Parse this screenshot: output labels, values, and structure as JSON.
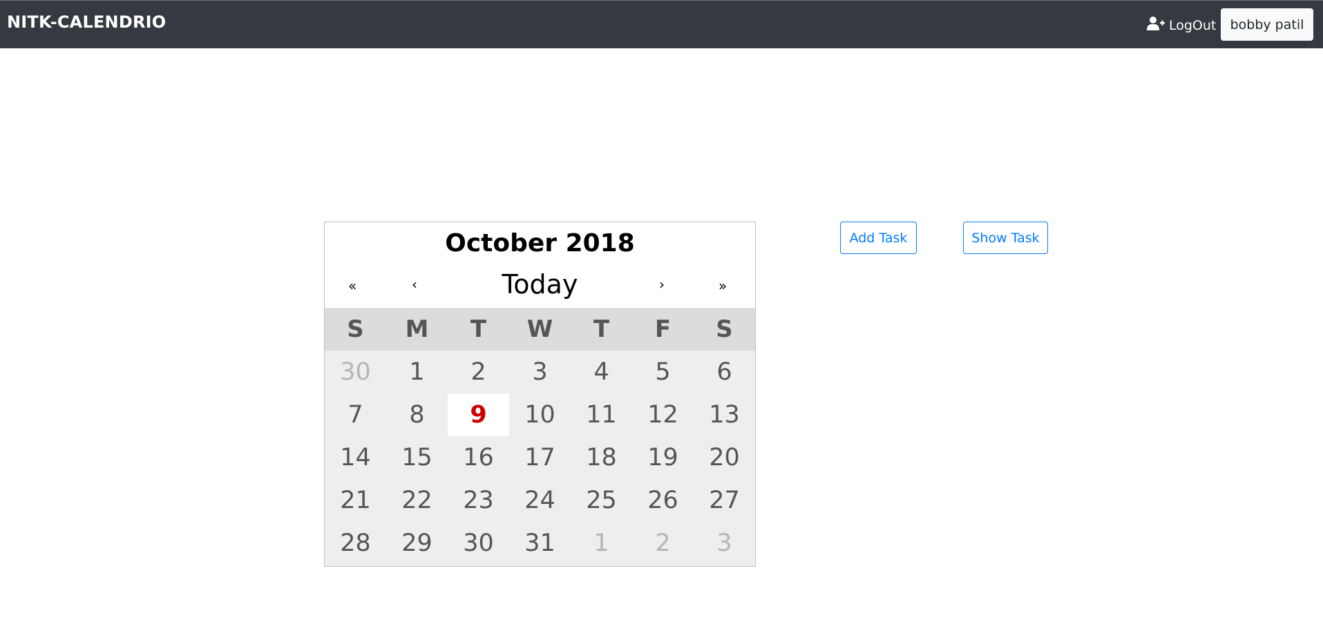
{
  "navbar": {
    "brand": "NITK-CALENDRIO",
    "logout_label": "LogOut",
    "logout_icon": "user-plus-icon",
    "user_name": "bobby patil"
  },
  "calendar": {
    "title": "October 2018",
    "nav": {
      "prev_year": "«",
      "prev_month": "‹",
      "today": "Today",
      "next_month": "›",
      "next_year": "»"
    },
    "weekdays": [
      "S",
      "M",
      "T",
      "W",
      "T",
      "F",
      "S"
    ],
    "days": [
      {
        "label": "30",
        "other": true
      },
      {
        "label": "1"
      },
      {
        "label": "2"
      },
      {
        "label": "3"
      },
      {
        "label": "4"
      },
      {
        "label": "5"
      },
      {
        "label": "6"
      },
      {
        "label": "7"
      },
      {
        "label": "8"
      },
      {
        "label": "9",
        "today": true
      },
      {
        "label": "10"
      },
      {
        "label": "11"
      },
      {
        "label": "12"
      },
      {
        "label": "13"
      },
      {
        "label": "14"
      },
      {
        "label": "15"
      },
      {
        "label": "16"
      },
      {
        "label": "17"
      },
      {
        "label": "18"
      },
      {
        "label": "19"
      },
      {
        "label": "20"
      },
      {
        "label": "21"
      },
      {
        "label": "22"
      },
      {
        "label": "23"
      },
      {
        "label": "24"
      },
      {
        "label": "25"
      },
      {
        "label": "26"
      },
      {
        "label": "27"
      },
      {
        "label": "28"
      },
      {
        "label": "29"
      },
      {
        "label": "30"
      },
      {
        "label": "31"
      },
      {
        "label": "1",
        "other": true
      },
      {
        "label": "2",
        "other": true
      },
      {
        "label": "3",
        "other": true
      }
    ],
    "today_color": "#cc0000"
  },
  "actions": {
    "add_task": "Add Task",
    "show_task": "Show Task",
    "accent": "#007bff"
  }
}
